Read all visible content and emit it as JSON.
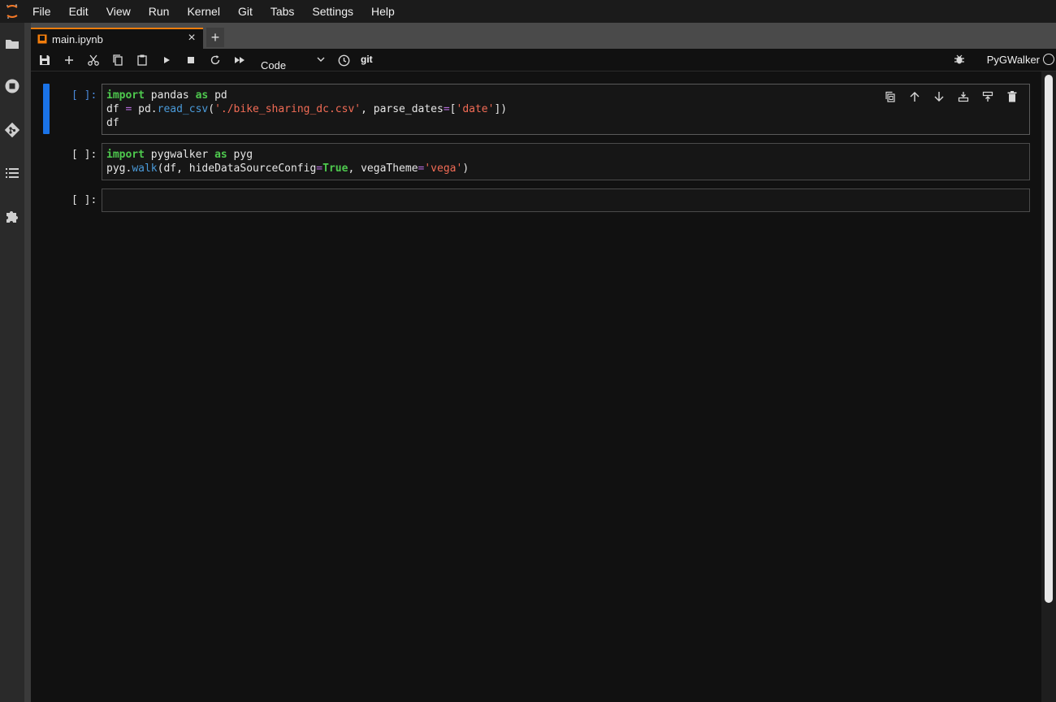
{
  "menu": [
    "File",
    "Edit",
    "View",
    "Run",
    "Kernel",
    "Git",
    "Tabs",
    "Settings",
    "Help"
  ],
  "tab": {
    "title": "main.ipynb",
    "close": "×",
    "add": "+"
  },
  "toolbar": {
    "cell_type": "Code",
    "git": "git",
    "kernel": "PyGWalker"
  },
  "sidebar_icons": [
    "folder-icon",
    "running-icon",
    "git-icon",
    "toc-icon",
    "extension-icon"
  ],
  "cells": [
    {
      "prompt": "[ ]:",
      "active": true,
      "lines": [
        "import pandas as pd",
        "df = pd.read_csv('./bike_sharing_dc.csv', parse_dates=['date'])",
        "df"
      ]
    },
    {
      "prompt": "[ ]:",
      "active": false,
      "lines": [
        "import pygwalker as pyg",
        "pyg.walk(df, hideDataSourceConfig=True, vegaTheme='vega')"
      ]
    },
    {
      "prompt": "[ ]:",
      "active": false,
      "lines": []
    }
  ],
  "colors": {
    "accent": "#1a73e8",
    "tab_accent": "#f27d0c",
    "keyword": "#4ec94e",
    "string": "#f16b55",
    "function": "#4a9ad9",
    "operator": "#b36bd8"
  }
}
